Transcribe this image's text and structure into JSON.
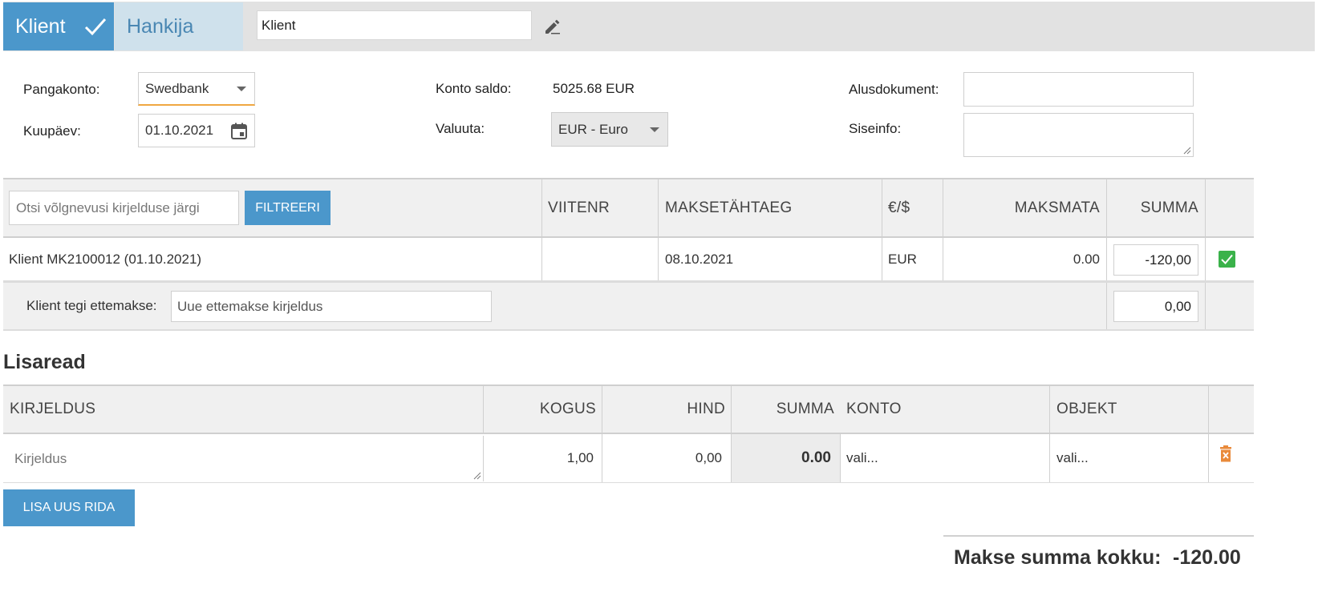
{
  "topbar": {
    "tab_klient": "Klient",
    "tab_hankija": "Hankija",
    "name_value": "Klient"
  },
  "form": {
    "pangakonto_label": "Pangakonto:",
    "pangakonto_value": "Swedbank",
    "kuupaev_label": "Kuupäev:",
    "kuupaev_value": "01.10.2021",
    "konto_saldo_label": "Konto saldo:",
    "konto_saldo_value": "5025.68 EUR",
    "valuuta_label": "Valuuta:",
    "valuuta_value": "EUR - Euro",
    "alusdokument_label": "Alusdokument:",
    "alusdokument_value": "",
    "siseinfo_label": "Siseinfo:",
    "siseinfo_value": ""
  },
  "debts": {
    "search_placeholder": "Otsi võlgnevusi kirjelduse järgi",
    "filter_button": "FILTREERI",
    "headers": {
      "viitenr": "VIITENR",
      "maksetahtaeg": "MAKSETÄHTAEG",
      "currency": "€/$",
      "maksmata": "MAKSMATA",
      "summa": "SUMMA"
    },
    "rows": [
      {
        "description": "Klient MK2100012 (01.10.2021)",
        "viitenr": "",
        "maksetahtaeg": "08.10.2021",
        "currency": "EUR",
        "maksmata": "0.00",
        "summa": "-120,00",
        "checked": true
      }
    ],
    "prepayment": {
      "label": "Klient tegi ettemakse:",
      "placeholder": "Uue ettemakse kirjeldus",
      "summa": "0,00"
    }
  },
  "extra_rows": {
    "title": "Lisaread",
    "headers": {
      "kirjeldus": "KIRJELDUS",
      "kogus": "KOGUS",
      "hind": "HIND",
      "summa": "SUMMA",
      "konto": "KONTO",
      "objekt": "OBJEKT"
    },
    "rows": [
      {
        "kirjeldus_placeholder": "Kirjeldus",
        "kogus": "1,00",
        "hind": "0,00",
        "summa": "0.00",
        "konto": "vali...",
        "objekt": "vali..."
      }
    ],
    "add_button": "LISA UUS RIDA"
  },
  "total": {
    "label": "Makse summa kokku:",
    "value": "-120.00"
  },
  "colors": {
    "accent_blue": "#4b97cb",
    "tab_inactive": "#cfe1ec",
    "check_green": "#3ab24a",
    "delete_orange": "#e98a3a",
    "focus_orange": "#f0a741"
  }
}
